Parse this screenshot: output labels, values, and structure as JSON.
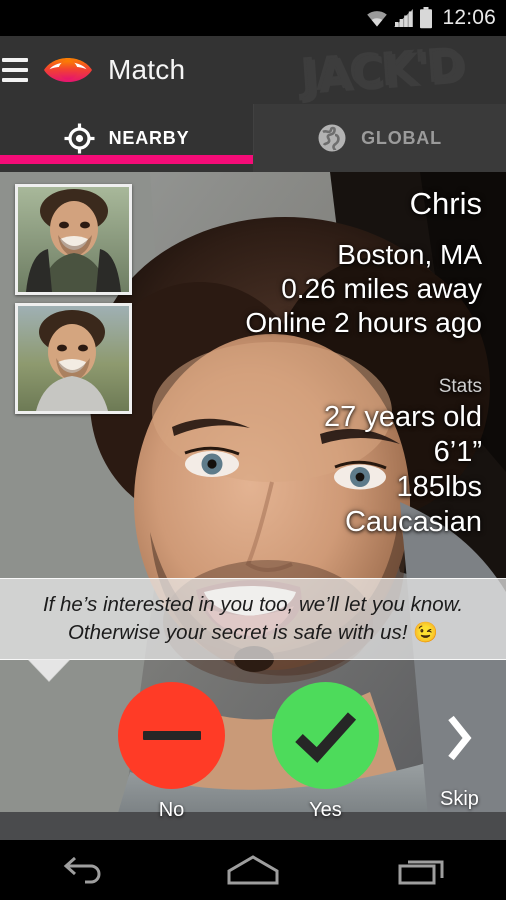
{
  "status_bar": {
    "time": "12:06",
    "icons": [
      "wifi-icon",
      "cellular-signal-icon",
      "battery-icon"
    ]
  },
  "action_bar": {
    "menu_icon": "hamburger-menu-icon",
    "logo_icon": "eye-logo-icon",
    "title": "Match",
    "watermark_text": "JACK'D",
    "brand_colors": {
      "eye_top": "#f97316",
      "eye_bottom": "#e8176b",
      "bar_background": "#333333"
    }
  },
  "tabs": {
    "items": [
      {
        "label": "NEARBY",
        "icon": "target-crosshair-icon",
        "active": true
      },
      {
        "label": "GLOBAL",
        "icon": "globe-icon",
        "active": false
      }
    ],
    "indicator_color": "#f50c78"
  },
  "profile": {
    "name": "Chris",
    "location": "Boston, MA",
    "distance": "0.26 miles away",
    "last_online": "Online 2 hours ago",
    "stats_label": "Stats",
    "stats": [
      "27 years old",
      "6’1”",
      "185lbs",
      "Caucasian"
    ],
    "thumbnails": [
      {
        "name": "profile-thumbnail-1"
      },
      {
        "name": "profile-thumbnail-2"
      }
    ]
  },
  "tooltip": {
    "line1": "If he’s interested in you too, we’ll let you know.",
    "line2": "Otherwise your secret is safe with us!",
    "emoji": "😉"
  },
  "actions": [
    {
      "key": "no",
      "label": "No",
      "icon": "minus-icon",
      "color": "#ff3b26"
    },
    {
      "key": "yes",
      "label": "Yes",
      "icon": "checkmark-icon",
      "color": "#4ddb5b"
    },
    {
      "key": "skip",
      "label": "Skip",
      "icon": "chevron-right-icon",
      "color": "#ffffff"
    }
  ],
  "nav_bar": {
    "buttons": [
      {
        "name": "back-icon"
      },
      {
        "name": "home-icon"
      },
      {
        "name": "recents-icon"
      }
    ]
  }
}
